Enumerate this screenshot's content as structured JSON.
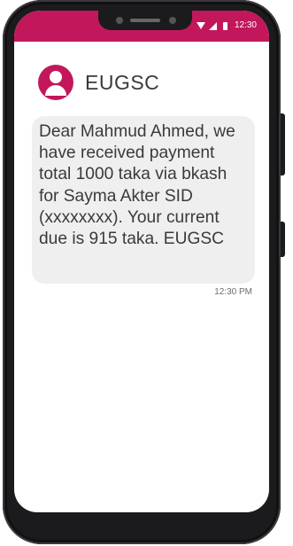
{
  "status_bar": {
    "time": "12:30",
    "icons": [
      "wifi-icon",
      "signal-icon",
      "battery-icon"
    ],
    "color": "#c2185b"
  },
  "conversation": {
    "sender": "EUGSC",
    "avatar_icon": "person-icon",
    "accent_color": "#c2185b"
  },
  "message": {
    "text": "Dear Mahmud Ahmed, we have received payment total 1000 taka via bkash for Sayma Akter SID (xxxxxxxx). Your current due is 915 taka. EUGSC",
    "time": "12:30 PM"
  }
}
